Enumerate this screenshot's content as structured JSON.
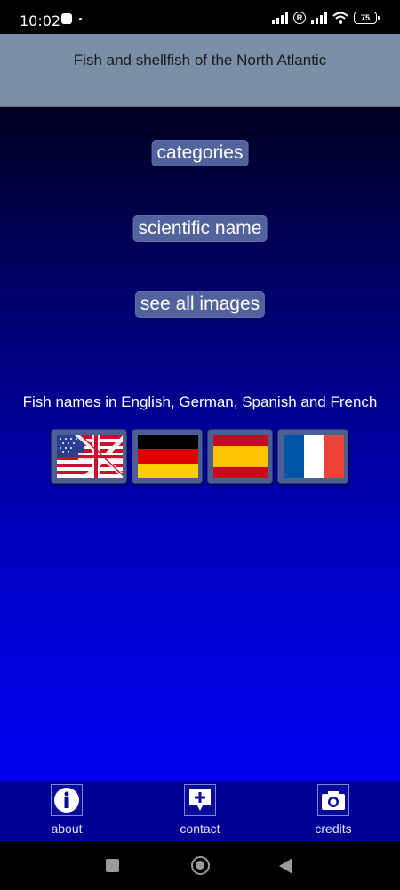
{
  "status_bar": {
    "time": "10:02",
    "roaming_badge": "R",
    "battery": "75"
  },
  "header": {
    "title": "Fish and shellfish of the North Atlantic"
  },
  "menu": {
    "categories_label": "categories",
    "scientific_label": "scientific name",
    "images_label": "see all images"
  },
  "languages": {
    "caption": "Fish names in English, German, Spanish and French",
    "flags": [
      "english-flag",
      "german-flag",
      "spanish-flag",
      "french-flag"
    ]
  },
  "bottom_nav": {
    "about_label": "about",
    "contact_label": "contact",
    "credits_label": "credits"
  },
  "colors": {
    "header_bg": "#7a8ea5",
    "button_bg": "#52629c",
    "gradient_top": "#00001f",
    "gradient_bottom": "#0000f2",
    "bottom_nav_bg": "#000094"
  }
}
